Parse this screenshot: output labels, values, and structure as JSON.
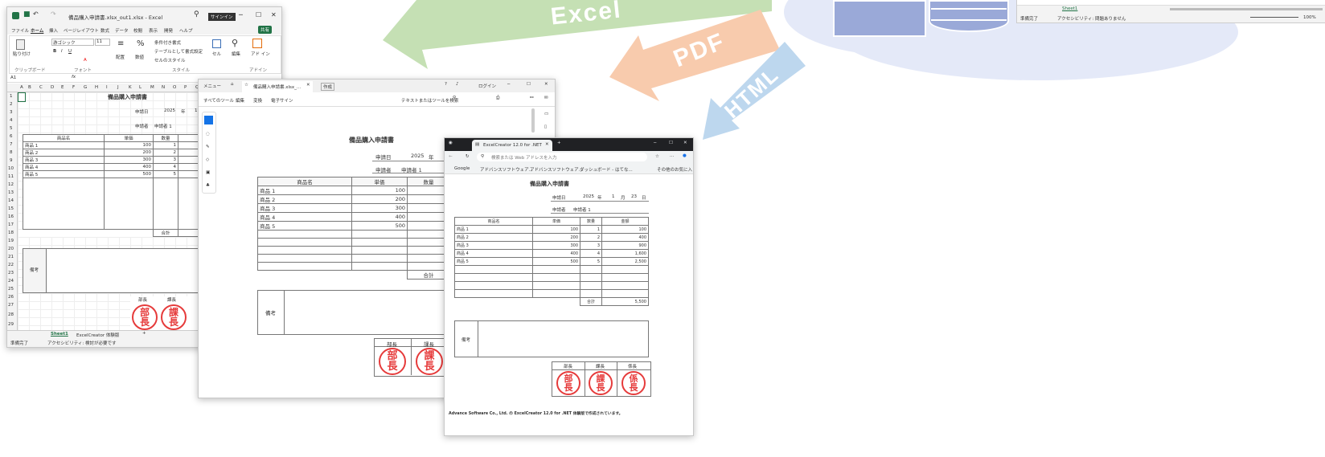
{
  "arrows": {
    "excel": "Excel",
    "pdf": "PDF",
    "html": "HTML"
  },
  "topright": {
    "status": "準備完了",
    "accessibility": "アクセシビリティ: 問題ありません",
    "sheet_tab": "Sheet1",
    "zoom": "100%"
  },
  "excel": {
    "title": "備品購入申請書.xlsx_out1.xlsx - Excel",
    "signin": "サインイン",
    "share": "共有",
    "menu": [
      "ファイル",
      "ホーム",
      "挿入",
      "ページレイアウト",
      "数式",
      "データ",
      "校閲",
      "表示",
      "開発",
      "ヘルプ"
    ],
    "font_name": "游ゴシック",
    "font_size": "11",
    "groups": {
      "clipboard": "クリップボード",
      "font": "フォント",
      "alignment": "配置",
      "number": "数値",
      "style": "スタイル",
      "cells": "セル",
      "editing": "編集",
      "addin": "アドイン"
    },
    "ribbon_buttons": {
      "paste": "貼り付け",
      "conditional": "条件付き書式",
      "table": "テーブルとして書式設定",
      "cell_style": "セルのスタイル",
      "cells": "セル",
      "edit": "編集",
      "addin": "アド イン"
    },
    "name_box": "A1",
    "fx": "fx",
    "col_headers": [
      "A",
      "B",
      "C",
      "D",
      "E",
      "F",
      "G",
      "H",
      "I",
      "J",
      "K",
      "L",
      "M",
      "N",
      "O",
      "P",
      "Q"
    ],
    "row_headers": [
      "1",
      "2",
      "3",
      "4",
      "5",
      "6",
      "7",
      "8",
      "9",
      "10",
      "11",
      "12",
      "13",
      "14",
      "15",
      "16",
      "17",
      "18",
      "19",
      "20",
      "21",
      "22",
      "23",
      "24",
      "25",
      "26",
      "27",
      "28",
      "29"
    ],
    "sheet_tabs": [
      "Sheet1",
      "ExcelCreator 体験版"
    ],
    "status": "準備完了",
    "accessibility": "アクセシビリティ: 検討が必要です"
  },
  "form": {
    "title": "備品購入申請書",
    "date_label": "申請日",
    "year": "2025",
    "year_unit": "年",
    "month": "1",
    "month_unit": "月",
    "day": "23",
    "day_unit": "日",
    "applicant_label": "申請者",
    "applicant": "申請者 1",
    "headers": [
      "商品名",
      "単価",
      "数量",
      "金額"
    ],
    "rows": [
      {
        "name": "商品 1",
        "price": "100",
        "qty": "1",
        "amount": "100"
      },
      {
        "name": "商品 2",
        "price": "200",
        "qty": "2",
        "amount": "400"
      },
      {
        "name": "商品 3",
        "price": "300",
        "qty": "3",
        "amount": "900"
      },
      {
        "name": "商品 4",
        "price": "400",
        "qty": "4",
        "amount": "1,600"
      },
      {
        "name": "商品 5",
        "price": "500",
        "qty": "5",
        "amount": "2,500"
      }
    ],
    "total_label": "合計",
    "total": "5,500",
    "remarks_label": "備考",
    "stamp_headers": [
      "部長",
      "課長",
      "係長"
    ],
    "stamps": [
      [
        "部",
        "長"
      ],
      [
        "課",
        "長"
      ],
      [
        "係",
        "長"
      ]
    ]
  },
  "pdf": {
    "menu": "メニュー",
    "tab_title": "備品購入申請書.xlsx_...",
    "new_tab": "作成",
    "login": "ログイン",
    "toolbar": [
      "すべてのツール",
      "編集",
      "変換",
      "電子サイン"
    ],
    "search_placeholder": "テキストまたはツールを検索"
  },
  "browser": {
    "tab_title": "ExcelCreator 12.0 for .NET",
    "address_placeholder": "検索または Web アドレスを入力",
    "bookmarks": [
      "Google",
      "アドバンスソフトウェア...",
      "アドバンスソフトウェア...",
      "ダッシュボード - はてな..."
    ],
    "other_favorites": "その他のお気に入り",
    "footer": "Advance Software Co., Ltd. の ExcelCreator 12.0 for .NET 体験版で作成されています。"
  }
}
